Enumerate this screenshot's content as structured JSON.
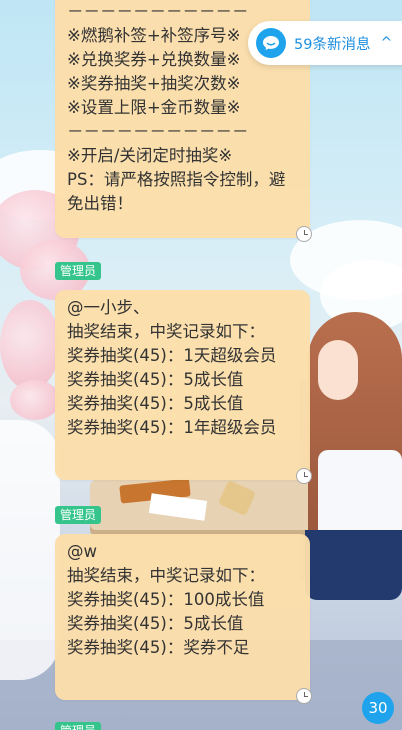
{
  "notification": {
    "text": "59条新消息",
    "chevron": "^",
    "icon": "chat-bubble-icon"
  },
  "messages": [
    {
      "lines": [
        "－－－－－－－－－－－",
        "※燃鹅补签+补签序号※",
        "※兑换奖券+兑换数量※",
        "※奖券抽奖+抽奖次数※",
        "※设置上限+金币数量※",
        "－－－－－－－－－－－",
        "※开启/关闭定时抽奖※",
        "PS：请严格按照指令控制，避",
        "免出错！"
      ]
    },
    {
      "sender_badge": "管理员",
      "lines": [
        "@一小步、",
        "抽奖结束，中奖记录如下：",
        "奖券抽奖(45)：1天超级会员",
        "奖券抽奖(45)：5成长值",
        "奖券抽奖(45)：5成长值",
        "奖券抽奖(45)：1年超级会员"
      ]
    },
    {
      "sender_badge": "管理员",
      "lines": [
        "@w",
        "抽奖结束，中奖记录如下：",
        "奖券抽奖(45)：100成长值",
        "奖券抽奖(45)：5成长值",
        "奖券抽奖(45)：奖券不足"
      ]
    }
  ],
  "next_sender_badge": "管理员",
  "unread_count": "30",
  "colors": {
    "bubble": "#fcdeaa",
    "admin_badge": "#35c48b",
    "accent_blue": "#1fa3ec"
  }
}
